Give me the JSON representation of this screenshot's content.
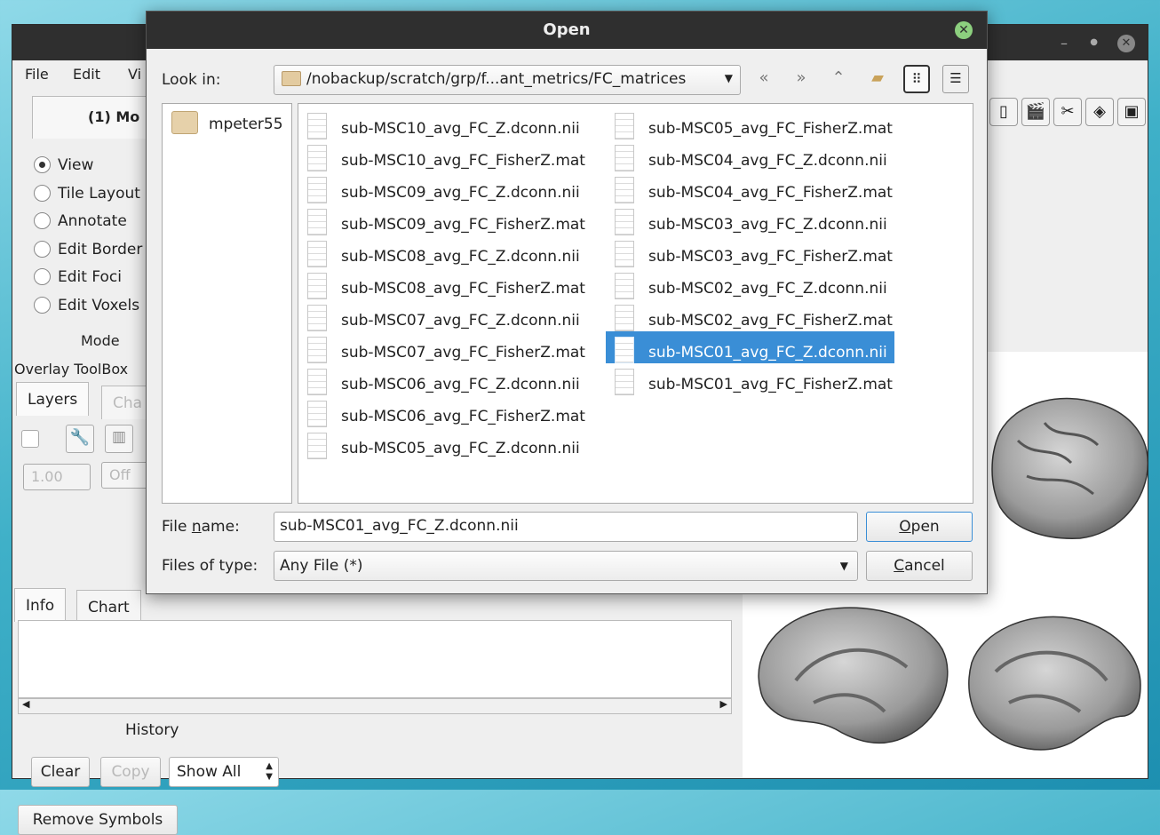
{
  "main_window": {
    "menu": [
      "File",
      "Edit",
      "Vi"
    ],
    "mode_tab_label": "(1) Mo",
    "modes": [
      "View",
      "Tile Layout",
      "Annotate",
      "Edit Border",
      "Edit Foci",
      "Edit Voxels"
    ],
    "selected_mode": "View",
    "mode_label": "Mode",
    "overlay_toolbox_label": "Overlay ToolBox",
    "overlay_tabs": [
      "Layers",
      "Cha"
    ],
    "opacity_value": "1.00",
    "off_value": "Off",
    "info_tabs": [
      "Info",
      "Chart"
    ],
    "history_label": "History",
    "clear_button": "Clear",
    "copy_button": "Copy",
    "show_select": "Show All",
    "remove_symbols_button": "Remove Symbols",
    "toolbar_icons": [
      "document-icon",
      "clapperboard-icon",
      "tools-icon",
      "layers-icon",
      "toolbox-icon"
    ]
  },
  "dialog": {
    "title": "Open",
    "look_in_label": "Look in:",
    "path": "/nobackup/scratch/grp/f...ant_metrics/FC_matrices",
    "nav_icons": [
      "back-icon",
      "forward-icon",
      "parent-folder-icon",
      "new-folder-icon",
      "icon-view-icon",
      "detail-view-icon"
    ],
    "sidebar": [
      "mpeter55"
    ],
    "files": [
      "sub-MSC10_avg_FC_Z.dconn.nii",
      "sub-MSC10_avg_FC_FisherZ.mat",
      "sub-MSC09_avg_FC_Z.dconn.nii",
      "sub-MSC09_avg_FC_FisherZ.mat",
      "sub-MSC08_avg_FC_Z.dconn.nii",
      "sub-MSC08_avg_FC_FisherZ.mat",
      "sub-MSC07_avg_FC_Z.dconn.nii",
      "sub-MSC07_avg_FC_FisherZ.mat",
      "sub-MSC06_avg_FC_Z.dconn.nii",
      "sub-MSC06_avg_FC_FisherZ.mat",
      "sub-MSC05_avg_FC_Z.dconn.nii",
      "sub-MSC05_avg_FC_FisherZ.mat",
      "sub-MSC04_avg_FC_Z.dconn.nii",
      "sub-MSC04_avg_FC_FisherZ.mat",
      "sub-MSC03_avg_FC_Z.dconn.nii",
      "sub-MSC03_avg_FC_FisherZ.mat",
      "sub-MSC02_avg_FC_Z.dconn.nii",
      "sub-MSC02_avg_FC_FisherZ.mat",
      "sub-MSC01_avg_FC_Z.dconn.nii",
      "sub-MSC01_avg_FC_FisherZ.mat"
    ],
    "selected_file": "sub-MSC01_avg_FC_Z.dconn.nii",
    "file_name_label_pre": "File ",
    "file_name_label_u": "n",
    "file_name_label_post": "ame:",
    "file_name_value": "sub-MSC01_avg_FC_Z.dconn.nii",
    "files_of_type_label": "Files of type:",
    "files_of_type_value": "Any File (*)",
    "open_button_u": "O",
    "open_button_rest": "pen",
    "cancel_button_u": "C",
    "cancel_button_rest": "ancel"
  }
}
